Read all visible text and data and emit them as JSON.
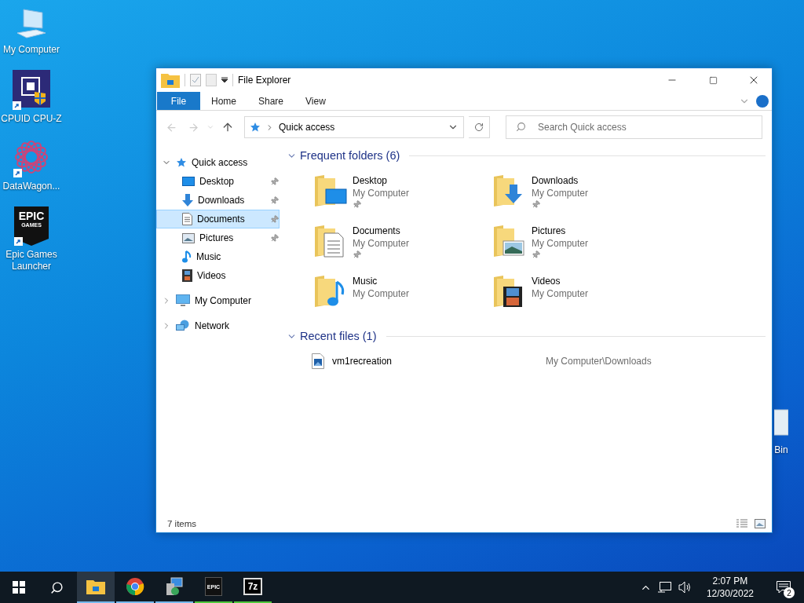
{
  "desktop_icons": [
    {
      "label": "My Computer",
      "kind": "computer",
      "shortcut": false
    },
    {
      "label": "CPUID CPU-Z",
      "kind": "cpuz",
      "shortcut": true
    },
    {
      "label": "DataWagon...",
      "kind": "datawagon",
      "shortcut": true
    },
    {
      "label": "Epic Games Launcher",
      "kind": "epic",
      "shortcut": true,
      "logo_text": [
        "EPIC",
        "GAMES"
      ]
    }
  ],
  "recycle_bin": {
    "label": "Bin"
  },
  "window": {
    "title": "File Explorer",
    "ribbon_tabs": [
      {
        "label": "File",
        "kind": "menu"
      },
      {
        "label": "Home",
        "kind": "tab"
      },
      {
        "label": "Share",
        "kind": "tab"
      },
      {
        "label": "View",
        "kind": "tab"
      }
    ],
    "address": {
      "path": "Quick access"
    },
    "search": {
      "placeholder": "Search Quick access"
    },
    "nav": [
      {
        "label": "Quick access",
        "kind": "quick",
        "expanded": true,
        "selected": false,
        "children": [
          {
            "label": "Desktop",
            "kind": "desktop",
            "pinned": true,
            "selected": false
          },
          {
            "label": "Downloads",
            "kind": "downloads",
            "pinned": true,
            "selected": false
          },
          {
            "label": "Documents",
            "kind": "documents",
            "pinned": true,
            "selected": true
          },
          {
            "label": "Pictures",
            "kind": "pictures",
            "pinned": true,
            "selected": false
          },
          {
            "label": "Music",
            "kind": "music",
            "pinned": false,
            "selected": false
          },
          {
            "label": "Videos",
            "kind": "videos",
            "pinned": false,
            "selected": false
          }
        ]
      },
      {
        "label": "My Computer",
        "kind": "computer",
        "expanded": false,
        "selected": false
      },
      {
        "label": "Network",
        "kind": "network",
        "expanded": false,
        "selected": false
      }
    ],
    "frequent_folders": {
      "title": "Frequent folders (6)",
      "expanded": true,
      "items": [
        {
          "name": "Desktop",
          "location": "My Computer",
          "kind": "desktop",
          "pinned": true
        },
        {
          "name": "Downloads",
          "location": "My Computer",
          "kind": "downloads",
          "pinned": true
        },
        {
          "name": "Documents",
          "location": "My Computer",
          "kind": "documents",
          "pinned": true
        },
        {
          "name": "Pictures",
          "location": "My Computer",
          "kind": "pictures",
          "pinned": true
        },
        {
          "name": "Music",
          "location": "My Computer",
          "kind": "music",
          "pinned": false
        },
        {
          "name": "Videos",
          "location": "My Computer",
          "kind": "videos",
          "pinned": false
        }
      ]
    },
    "recent_files": {
      "title": "Recent files (1)",
      "expanded": true,
      "files": [
        {
          "name": "vm1recreation",
          "path": "My Computer\\Downloads"
        }
      ]
    },
    "status_bar": {
      "item_count": "7 items"
    }
  },
  "taskbar": {
    "items": [
      {
        "kind": "explorer",
        "selected": true,
        "color": "#76b9ed"
      },
      {
        "kind": "chrome",
        "selected": false,
        "color": "#76b9ed"
      },
      {
        "kind": "app",
        "selected": false,
        "color": "#76b9ed"
      },
      {
        "kind": "epic",
        "selected": false,
        "color": "#4fc83c",
        "text": "EPIC"
      },
      {
        "kind": "sevenzip",
        "selected": false,
        "color": "#4fc83c",
        "text": "7z"
      }
    ],
    "time": "2:07 PM",
    "date": "12/30/2022",
    "notifications": "2"
  }
}
